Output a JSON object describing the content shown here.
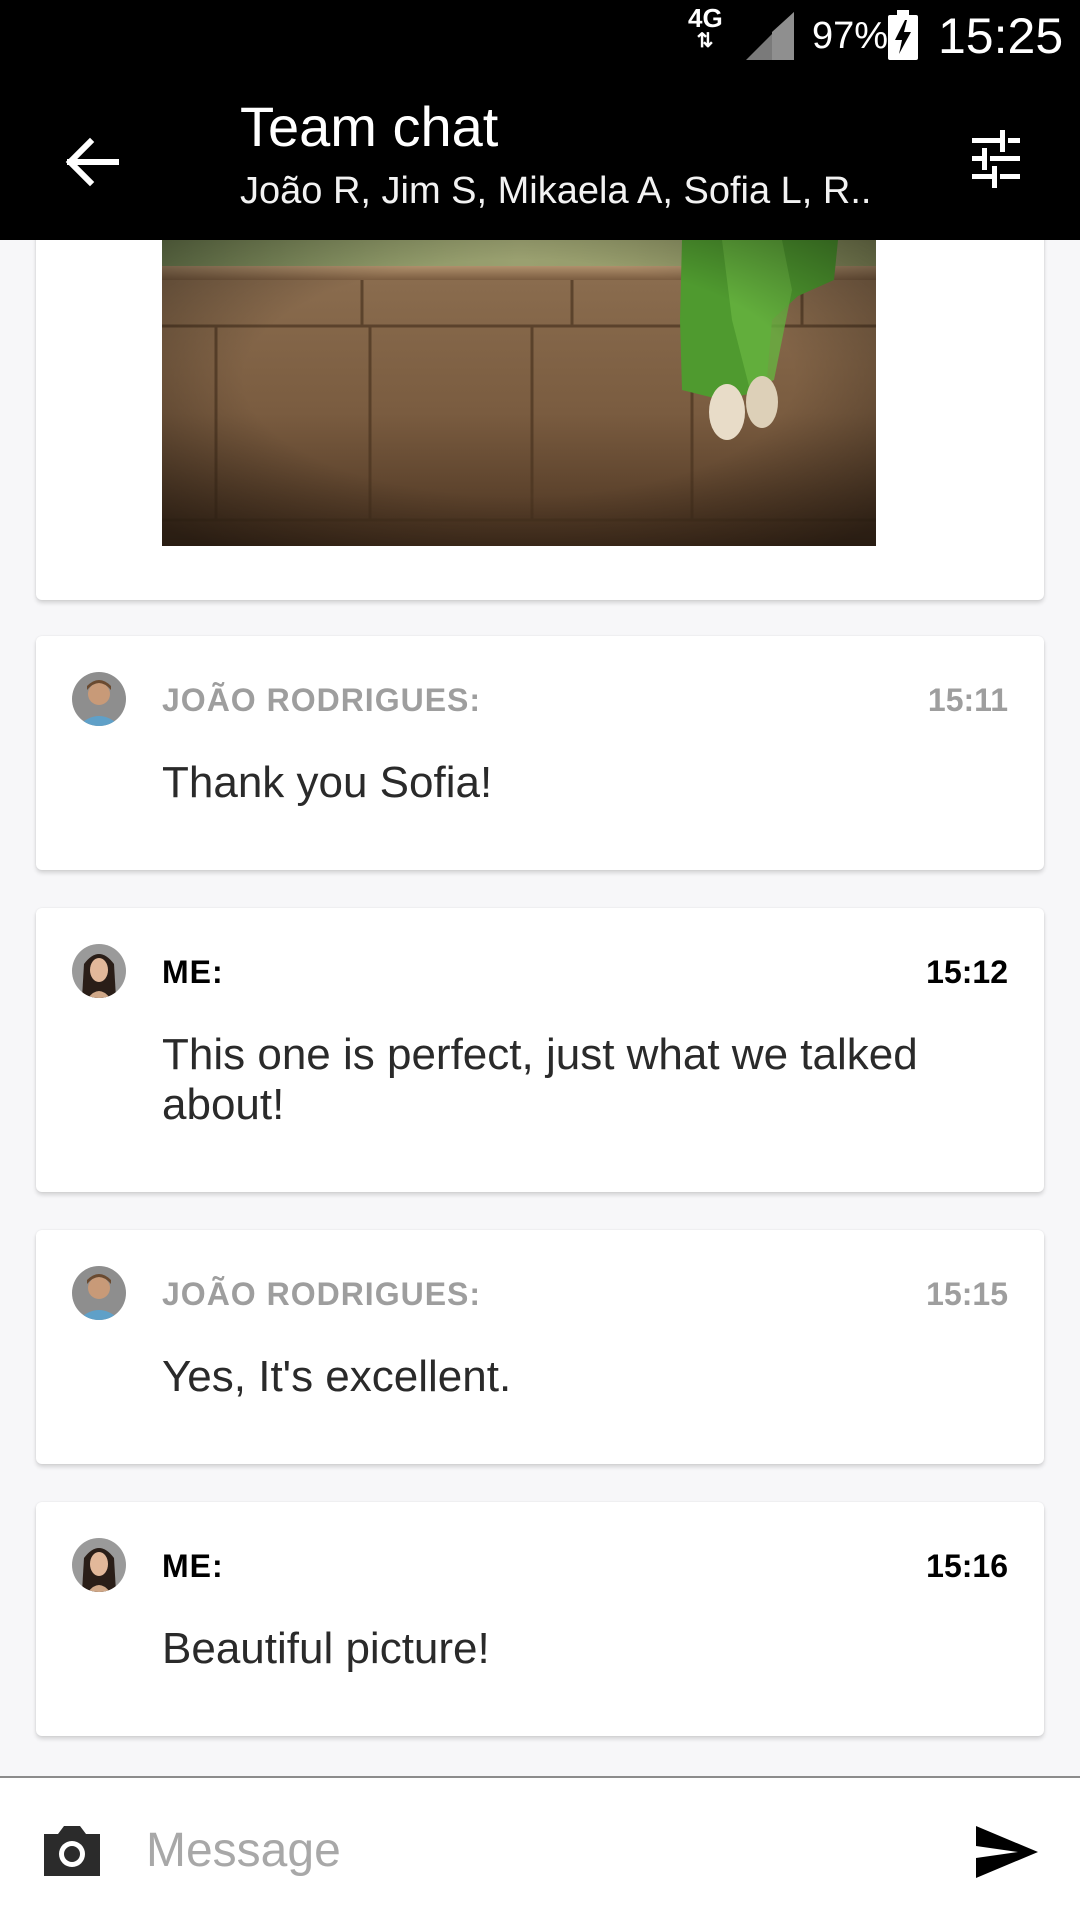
{
  "status_bar": {
    "network": "4G",
    "battery_percent": "97%",
    "time": "15:25"
  },
  "header": {
    "title": "Team chat",
    "subtitle": "João R, Jim S, Mikaela A, Sofia L, R.."
  },
  "composer": {
    "placeholder": "Message"
  },
  "messages": [
    {
      "sender": "JOÃO RODRIGUES:",
      "time": "15:11",
      "text": "Thank you Sofia!",
      "is_me": false
    },
    {
      "sender": "ME:",
      "time": "15:12",
      "text": "This one is perfect, just what we talked about!",
      "is_me": true
    },
    {
      "sender": "JOÃO RODRIGUES:",
      "time": "15:15",
      "text": "Yes, It's excellent.",
      "is_me": false
    },
    {
      "sender": "ME:",
      "time": "15:16",
      "text": "Beautiful picture!",
      "is_me": true
    }
  ],
  "icons": {
    "back": "arrow-left-icon",
    "filter": "tune-sliders-icon",
    "camera": "camera-icon",
    "send": "send-icon"
  },
  "colors": {
    "appbar": "#000000",
    "background": "#f7f7f9",
    "other_sender": "#9e9e9e",
    "me_sender": "#000000"
  }
}
